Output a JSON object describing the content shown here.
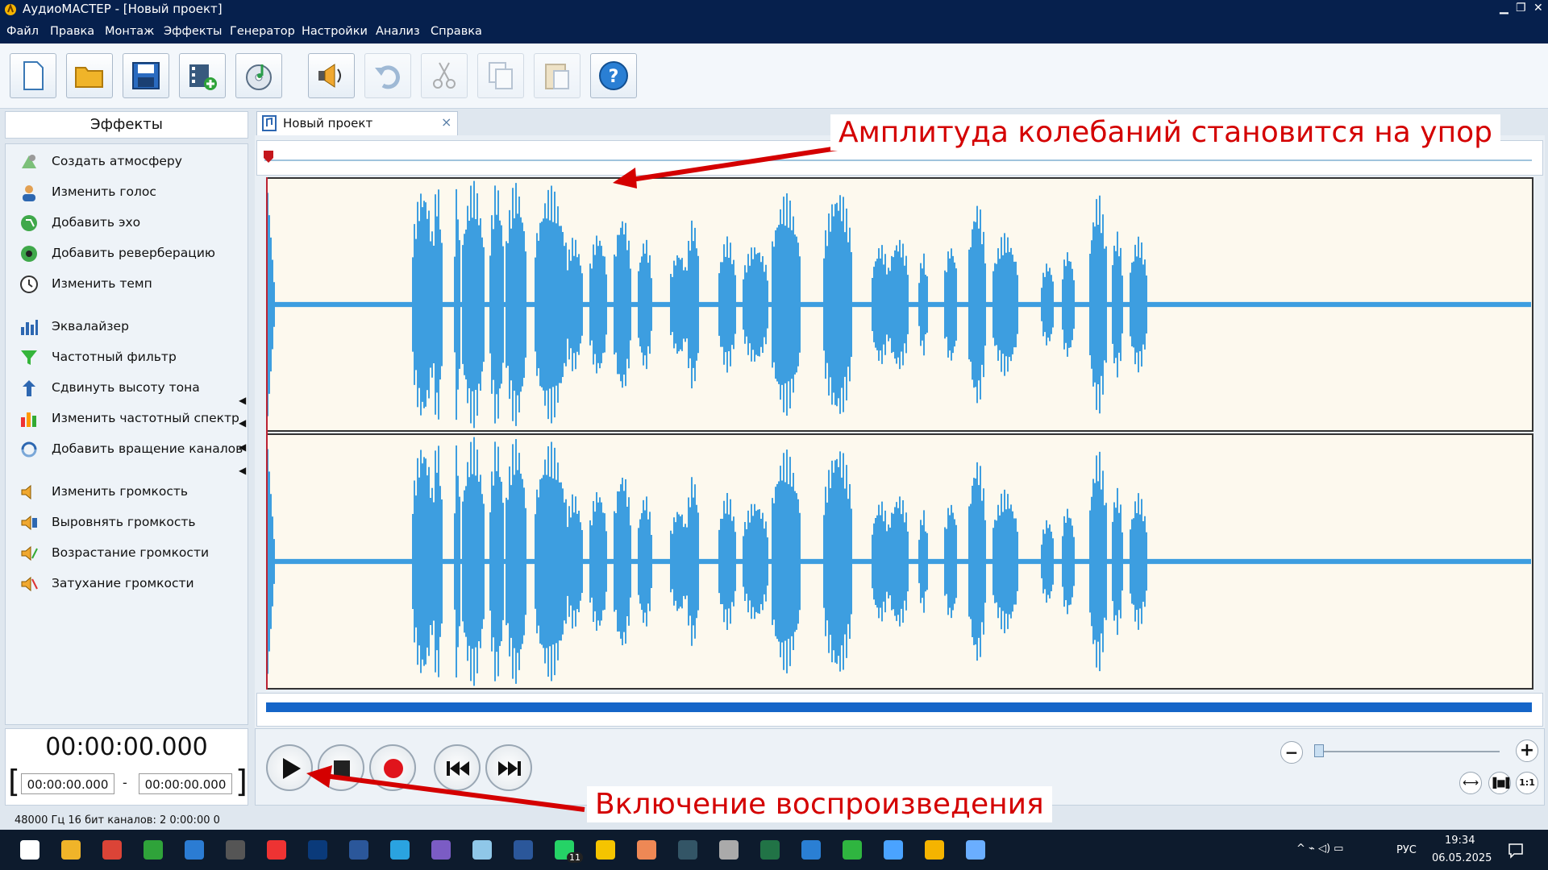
{
  "window": {
    "title": "АудиоМАСТЕР - [Новый проект]"
  },
  "menu": [
    "Файл",
    "Правка",
    "Монтаж",
    "Эффекты",
    "Генератор",
    "Настройки",
    "Анализ",
    "Справка"
  ],
  "toolbar": {
    "buttons": [
      {
        "icon": "new-file-icon",
        "enabled": true
      },
      {
        "icon": "open-folder-icon",
        "enabled": true
      },
      {
        "icon": "save-icon",
        "enabled": true
      },
      {
        "icon": "add-video-icon",
        "enabled": true
      },
      {
        "icon": "cd-music-icon",
        "enabled": true
      },
      {
        "icon": "speaker-effect-icon",
        "enabled": true
      },
      {
        "icon": "undo-icon",
        "enabled": false
      },
      {
        "icon": "cut-icon",
        "enabled": false
      },
      {
        "icon": "copy-icon",
        "enabled": false
      },
      {
        "icon": "paste-icon",
        "enabled": false
      },
      {
        "icon": "help-icon",
        "enabled": true
      }
    ]
  },
  "effects_panel": {
    "header": "Эффекты",
    "items": [
      {
        "label": "Создать атмосферу",
        "icon": "atmosphere-icon"
      },
      {
        "label": "Изменить голос",
        "icon": "voice-icon"
      },
      {
        "label": "Добавить эхо",
        "icon": "echo-icon"
      },
      {
        "label": "Добавить реверберацию",
        "icon": "reverb-icon"
      },
      {
        "label": "Изменить темп",
        "icon": "tempo-clock-icon"
      },
      {
        "label": "Эквалайзер",
        "icon": "equalizer-icon"
      },
      {
        "label": "Частотный фильтр",
        "icon": "filter-funnel-icon"
      },
      {
        "label": "Сдвинуть высоту тона",
        "icon": "pitch-shift-icon"
      },
      {
        "label": "Изменить частотный спектр",
        "icon": "spectrum-icon"
      },
      {
        "label": "Добавить вращение каналов",
        "icon": "channel-rotate-icon"
      },
      {
        "label": "Изменить громкость",
        "icon": "volume-icon"
      },
      {
        "label": "Выровнять громкость",
        "icon": "normalize-volume-icon"
      },
      {
        "label": "Возрастание громкости",
        "icon": "fade-in-icon"
      },
      {
        "label": "Затухание громкости",
        "icon": "fade-out-icon"
      }
    ]
  },
  "project_tab": {
    "label": "Новый проект",
    "close": "×"
  },
  "time": {
    "current": "00:00:00.000",
    "selection_start": "00:00:00.000",
    "separator": "-",
    "selection_end": "00:00:00.000"
  },
  "zoom": {
    "minus": "−",
    "plus": "+",
    "fit_label": "1:1",
    "level": 0.02
  },
  "status_bar": {
    "text": "48000 Гц  16 бит  каналов: 2   0:00:00 0"
  },
  "annotations": {
    "top": "Амплитуда колебаний становится на упор",
    "bottom": "Включение воспроизведения"
  },
  "colors": {
    "waveform": "#3d9ee0",
    "annotation": "#d40000",
    "titlebar": "#06204d",
    "scrollbar": "#1565c8"
  },
  "taskbar": {
    "apps": [
      "windows-start-icon",
      "file-explorer-icon",
      "chrome-icon",
      "camtasia-icon",
      "outlook-icon",
      "calculator-icon",
      "yandex-browser-icon",
      "photoshop-icon",
      "word-icon",
      "telegram-icon",
      "viber-icon",
      "notes-icon",
      "visio-icon",
      "whatsapp-icon",
      "emoji-app-icon",
      "color-app-icon",
      "pen-app-icon",
      "video-reel-icon",
      "excel-icon",
      "ccleaner-icon",
      "utorrent-icon",
      "remote-desktop-icon",
      "audiomaster-icon",
      "weather-icon"
    ],
    "whatsapp_badge": "11",
    "lang": "РУС",
    "time": "19:34",
    "date": "06.05.2025"
  }
}
